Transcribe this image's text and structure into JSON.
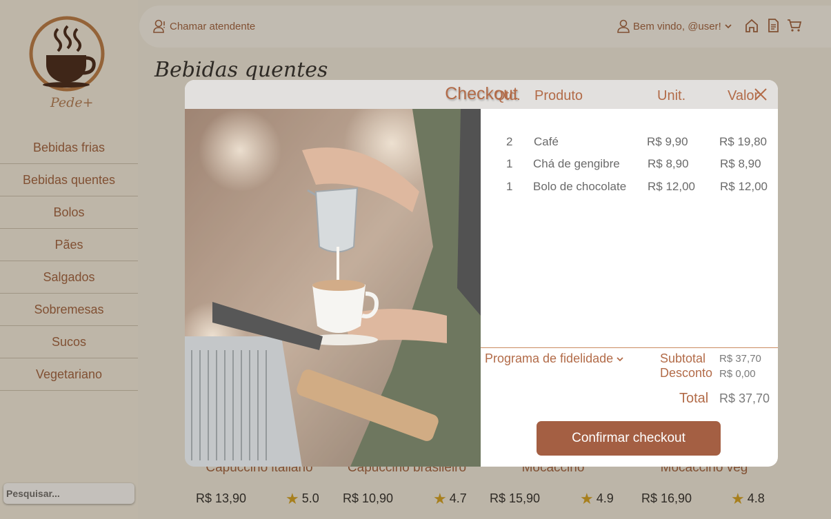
{
  "brand": {
    "name": "Pede+"
  },
  "sidebar": {
    "items": [
      {
        "label": "Bebidas frias"
      },
      {
        "label": "Bebidas quentes"
      },
      {
        "label": "Bolos"
      },
      {
        "label": "Pães"
      },
      {
        "label": "Salgados"
      },
      {
        "label": "Sobremesas"
      },
      {
        "label": "Sucos"
      },
      {
        "label": "Vegetariano"
      }
    ],
    "search_placeholder": "Pesquisar..."
  },
  "topbar": {
    "call_attendant": "Chamar atendente",
    "welcome": "Bem vindo, @user!",
    "icons": [
      "user-headset-icon",
      "user-icon",
      "chevron-down-icon",
      "home-icon",
      "document-icon",
      "cart-icon"
    ]
  },
  "page": {
    "title": "Bebidas quentes"
  },
  "products": [
    {
      "name": "Capuccino italiano",
      "price": "R$ 13,90",
      "rating": "5.0"
    },
    {
      "name": "Capuccino brasileiro",
      "price": "R$ 10,90",
      "rating": "4.7"
    },
    {
      "name": "Mocaccino",
      "price": "R$ 15,90",
      "rating": "4.9"
    },
    {
      "name": "Mocaccino veg",
      "price": "R$ 16,90",
      "rating": "4.8"
    }
  ],
  "checkout": {
    "title": "Checkout",
    "headers": {
      "qty": "Qtd.",
      "product": "Produto",
      "unit": "Unit.",
      "value": "Valor"
    },
    "rows": [
      {
        "qty": "2",
        "product": "Café",
        "unit": "R$ 9,90",
        "value": "R$ 19,80"
      },
      {
        "qty": "1",
        "product": "Chá de gengibre",
        "unit": "R$ 8,90",
        "value": "R$ 8,90"
      },
      {
        "qty": "1",
        "product": "Bolo de chocolate",
        "unit": "R$ 12,00",
        "value": "R$ 12,00"
      }
    ],
    "loyalty_label": "Programa de fidelidade",
    "subtotal_label": "Subtotal",
    "subtotal_value": "R$ 37,70",
    "discount_label": "Desconto",
    "discount_value": "R$ 0,00",
    "total_label": "Total",
    "total_value": "R$ 37,70",
    "confirm_label": "Confirmar checkout"
  },
  "colors": {
    "accent": "#b26b48",
    "button": "#a45f43",
    "star": "#d4a017"
  }
}
